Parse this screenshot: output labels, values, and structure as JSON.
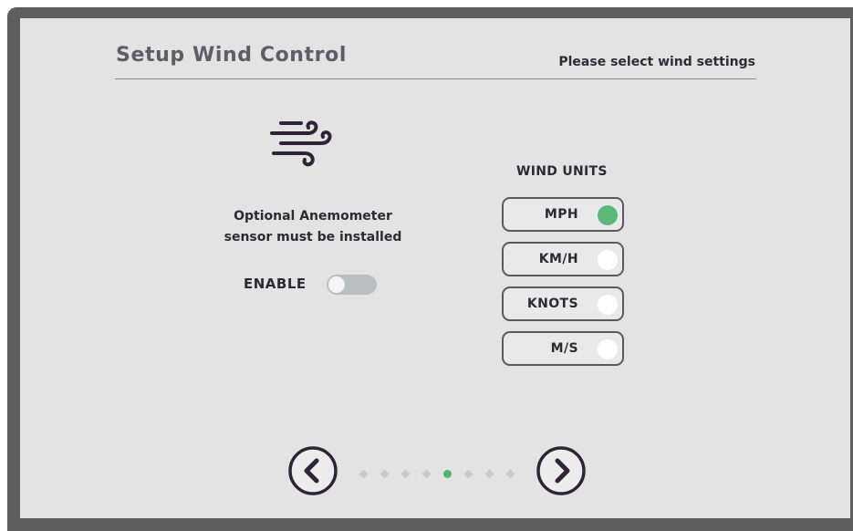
{
  "header": {
    "title": "Setup Wind Control",
    "subtitle": "Please select wind settings"
  },
  "sensor": {
    "note_line1": "Optional Anemometer",
    "note_line2": "sensor must be installed",
    "enable_label": "ENABLE",
    "enabled": false
  },
  "units": {
    "title": "WIND UNITS",
    "options": [
      {
        "label": "MPH",
        "selected": true
      },
      {
        "label": "KM/H",
        "selected": false
      },
      {
        "label": "KNOTS",
        "selected": false
      },
      {
        "label": "M/S",
        "selected": false
      }
    ]
  },
  "pager": {
    "total_pages": 8,
    "current_page": 5
  },
  "colors": {
    "accent": "#5bb978",
    "screen": "#e3e3e3",
    "bezel": "#5e5e5e",
    "text": "#2b2b33"
  },
  "icons": {
    "wind": "wind-icon",
    "prev": "chevron-left-icon",
    "next": "chevron-right-icon"
  }
}
